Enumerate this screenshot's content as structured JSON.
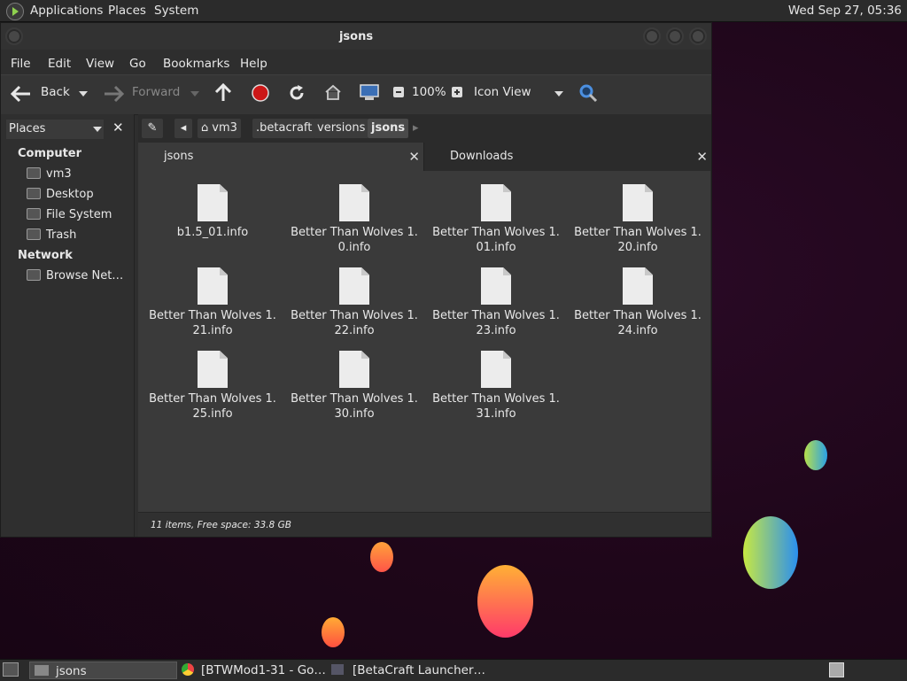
{
  "top_panel": {
    "menus": [
      "Applications",
      "Places",
      "System"
    ],
    "clock": "Wed Sep 27, 05:36"
  },
  "window": {
    "title": "jsons",
    "menubar": [
      "File",
      "Edit",
      "View",
      "Go",
      "Bookmarks",
      "Help"
    ],
    "toolbar": {
      "back_label": "Back",
      "forward_label": "Forward",
      "zoom": "100%",
      "view_mode": "Icon View"
    },
    "sidebar": {
      "header": "Places",
      "sections": [
        {
          "title": "Computer",
          "items": [
            "vm3",
            "Desktop",
            "File System",
            "Trash"
          ]
        },
        {
          "title": "Network",
          "items": [
            "Browse Net…"
          ]
        }
      ]
    },
    "breadcrumb": [
      "vm3",
      ".betacraft",
      "versions",
      "jsons"
    ],
    "tabs": [
      "jsons",
      "Downloads"
    ],
    "files": [
      {
        "l1": "b1.5_01.info",
        "l2": ""
      },
      {
        "l1": "Better Than Wolves 1.",
        "l2": "0.info"
      },
      {
        "l1": "Better Than Wolves 1.",
        "l2": "01.info"
      },
      {
        "l1": "Better Than Wolves 1.",
        "l2": "20.info"
      },
      {
        "l1": "Better Than Wolves 1.",
        "l2": "21.info"
      },
      {
        "l1": "Better Than Wolves 1.",
        "l2": "22.info"
      },
      {
        "l1": "Better Than Wolves 1.",
        "l2": "23.info"
      },
      {
        "l1": "Better Than Wolves 1.",
        "l2": "24.info"
      },
      {
        "l1": "Better Than Wolves 1.",
        "l2": "25.info"
      },
      {
        "l1": "Better Than Wolves 1.",
        "l2": "30.info"
      },
      {
        "l1": "Better Than Wolves 1.",
        "l2": "31.info"
      }
    ],
    "status": "11 items, Free space: 33.8 GB"
  },
  "taskbar": {
    "tasks": [
      "jsons",
      "[BTWMod1-31 - Go…",
      "[BetaCraft Launcher…"
    ]
  }
}
